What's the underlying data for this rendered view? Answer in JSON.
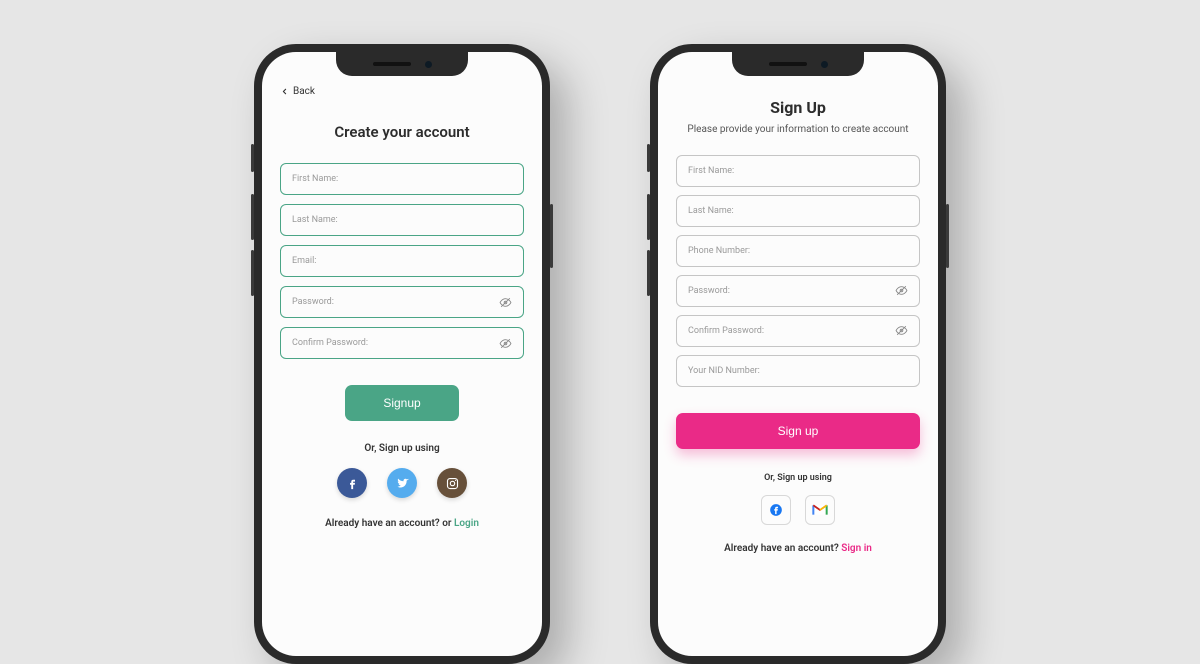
{
  "left": {
    "back_label": "Back",
    "title": "Create your account",
    "fields": {
      "first_name": "First Name:",
      "last_name": "Last Name:",
      "email": "Email:",
      "password": "Password:",
      "confirm_password": "Confirm Password:"
    },
    "signup_btn": "Signup",
    "alt_label": "Or, Sign up using",
    "footer_prefix": "Already have an account? or ",
    "footer_link": "Login"
  },
  "right": {
    "title": "Sign Up",
    "subtitle": "Please provide your information to\ncreate account",
    "fields": {
      "first_name": "First Name:",
      "last_name": "Last Name:",
      "phone": "Phone Number:",
      "password": "Password:",
      "confirm_password": "Confirm Password:",
      "nid": "Your NID Number:"
    },
    "signup_btn": "Sign up",
    "alt_label": "Or, Sign up using",
    "footer_prefix": "Already have an account? ",
    "footer_link": "Sign in"
  }
}
